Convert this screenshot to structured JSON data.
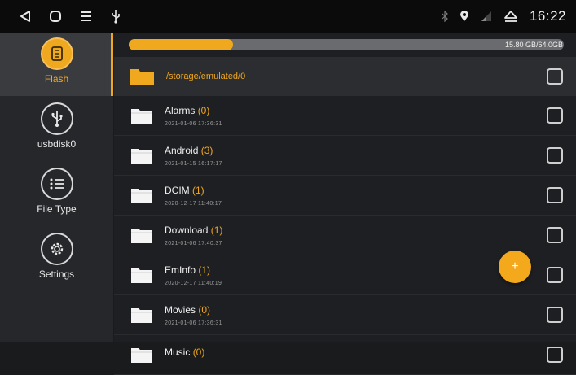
{
  "statusbar": {
    "icons": [
      "back-icon",
      "home-icon",
      "menu-icon",
      "usb-icon",
      "bluetooth-icon",
      "location-icon",
      "signal-icon",
      "eject-icon"
    ],
    "time": "16:22"
  },
  "sidebar": {
    "items": [
      {
        "label": "Flash",
        "icon": "sd-card-icon",
        "active": true
      },
      {
        "label": "usbdisk0",
        "icon": "usb-icon",
        "active": false
      },
      {
        "label": "File Type",
        "icon": "list-icon",
        "active": false
      },
      {
        "label": "Settings",
        "icon": "gear-icon",
        "active": false
      }
    ]
  },
  "storage": {
    "used_fraction": 0.24,
    "text": "15.80 GB/64.0GB"
  },
  "path": "/storage/emulated/0",
  "folders": [
    {
      "name": "Alarms",
      "count": "(0)",
      "date": "2021-01-06 17:36:31"
    },
    {
      "name": "Android",
      "count": "(3)",
      "date": "2021-01-15 16:17:17"
    },
    {
      "name": "DCIM",
      "count": "(1)",
      "date": "2020-12-17 11:40:17"
    },
    {
      "name": "Download",
      "count": "(1)",
      "date": "2021-01-06 17:40:37"
    },
    {
      "name": "EmInfo",
      "count": "(1)",
      "date": "2020-12-17 11:40:19"
    },
    {
      "name": "Movies",
      "count": "(0)",
      "date": "2021-01-06 17:36:31"
    },
    {
      "name": "Music",
      "count": "(0)",
      "date": ""
    }
  ],
  "fab": {
    "label": "+"
  },
  "colors": {
    "accent": "#f0a81f",
    "background": "#1e1f22",
    "sidebar": "#26272a"
  }
}
